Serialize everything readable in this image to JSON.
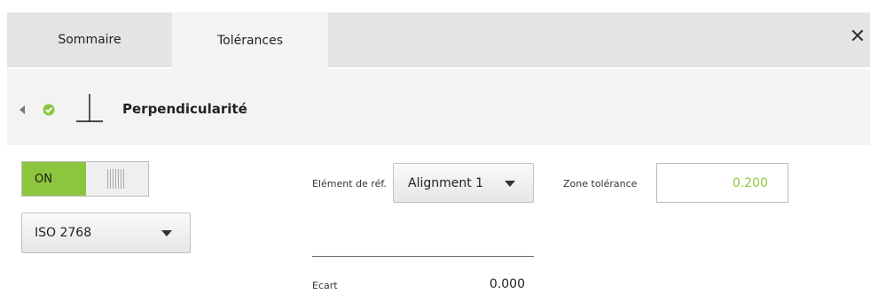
{
  "tabs": [
    {
      "label": "Sommaire",
      "active": false
    },
    {
      "label": "Tolérances",
      "active": true
    }
  ],
  "close_icon": "close-icon",
  "header": {
    "title": "Perpendicularité",
    "status": "ok",
    "symbol": "perpendicularity-icon"
  },
  "toggle": {
    "label": "ON",
    "state": true
  },
  "standard": {
    "selected": "ISO 2768"
  },
  "reference": {
    "label": "Elément de réf.",
    "selected": "Alignment 1"
  },
  "tolerance_zone": {
    "label": "Zone tolérance",
    "value": "0.200"
  },
  "deviation": {
    "label": "Ecart",
    "value": "0.000"
  },
  "colors": {
    "accent": "#8cc63f",
    "tab_bar": "#e4e4e4",
    "header_bg": "#f3f3f3"
  }
}
